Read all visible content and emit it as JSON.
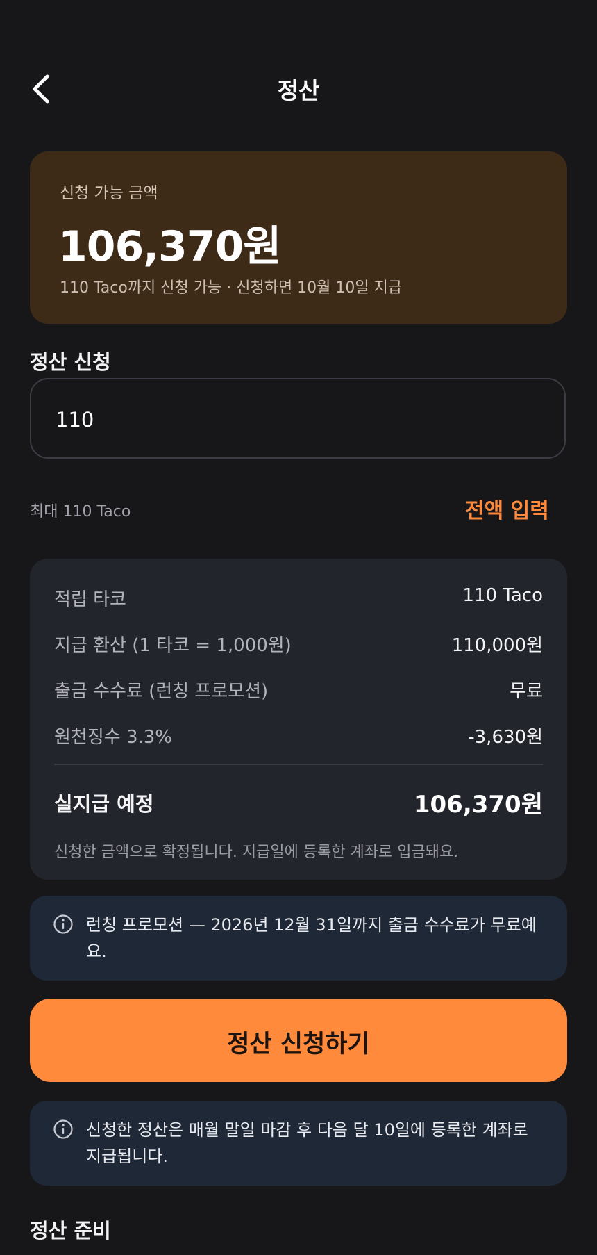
{
  "header": {
    "title": "정산"
  },
  "summary": {
    "label": "신청 가능 금액",
    "amount": "106,370원",
    "note": "110 Taco까지 신청 가능 · 신청하면 10월 10일 지급"
  },
  "request": {
    "section_label": "정산 신청",
    "input_value": "110",
    "max_text": "최대 110 Taco",
    "fill_all_label": "전액 입력"
  },
  "details": {
    "rows": [
      {
        "label": "적립 타코",
        "value": "110 Taco"
      },
      {
        "label": "지급 환산 (1 타코 = 1,000원)",
        "value": "110,000원"
      },
      {
        "label": "출금 수수료 (런칭 프로모션)",
        "value": "무료"
      },
      {
        "label": "원천징수 3.3%",
        "value": "-3,630원"
      }
    ],
    "total_label": "실지급 예정",
    "total_value": "106,370원",
    "note": "신청한 금액으로 확정됩니다. 지급일에 등록한 계좌로 입금돼요."
  },
  "promo_info": {
    "text": "런칭 프로모션 — 2026년 12월 31일까지 출금 수수료가 무료예요."
  },
  "cta": {
    "label": "정산 신청하기"
  },
  "schedule_info": {
    "text": "신청한 정산은 매월 말일 마감 후 다음 달 10일에 등록한 계좌로 지급됩니다."
  },
  "bottom": {
    "section_label": "정산 준비"
  },
  "colors": {
    "accent": "#ff8a3c",
    "summary_bg": "#3d2a17",
    "card_bg": "#23252c",
    "info_bg": "#1e2836",
    "page_bg": "#17171a"
  },
  "icons": {
    "back": "chevron-left-icon",
    "info": "info-circle-icon"
  }
}
